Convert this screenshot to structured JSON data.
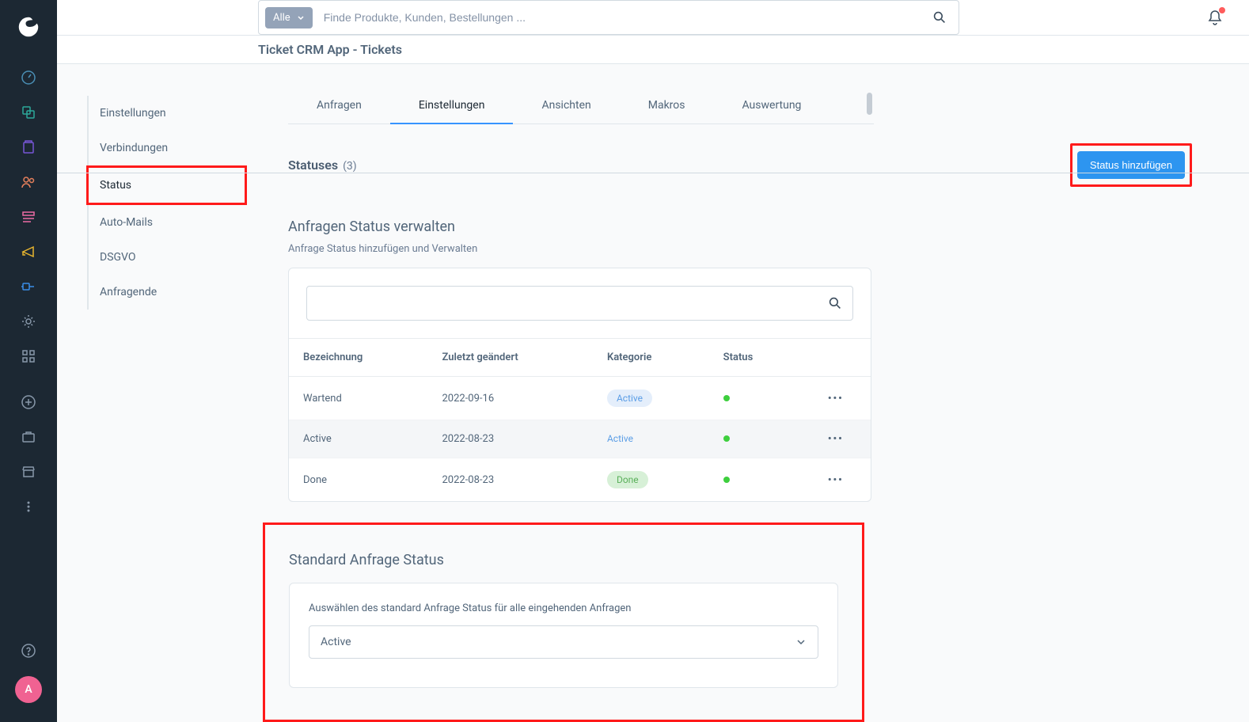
{
  "search": {
    "filter": "Alle",
    "placeholder": "Finde Produkte, Kunden, Bestellungen ..."
  },
  "page_title": "Ticket CRM App - Tickets",
  "avatar_letter": "A",
  "tabs": [
    "Anfragen",
    "Einstellungen",
    "Ansichten",
    "Makros",
    "Auswertung"
  ],
  "active_tab": "Einstellungen",
  "subheader": {
    "title": "Statuses",
    "count": "(3)",
    "add_label": "Status hinzufügen"
  },
  "side_menu": [
    "Einstellungen",
    "Verbindungen",
    "Status",
    "Auto-Mails",
    "DSGVO",
    "Anfragende"
  ],
  "active_side": "Status",
  "section": {
    "title": "Anfragen Status verwalten",
    "subtitle": "Anfrage Status hinzufügen und Verwalten"
  },
  "table": {
    "headers": [
      "Bezeichnung",
      "Zuletzt geändert",
      "Kategorie",
      "Status",
      ""
    ],
    "rows": [
      {
        "name": "Wartend",
        "date": "2022-09-16",
        "category": "Active",
        "cat_type": "active",
        "status": "green"
      },
      {
        "name": "Active",
        "date": "2022-08-23",
        "category": "Active",
        "cat_type": "active",
        "status": "green",
        "highlight": true
      },
      {
        "name": "Done",
        "date": "2022-08-23",
        "category": "Done",
        "cat_type": "done",
        "status": "green"
      }
    ]
  },
  "standard": {
    "title": "Standard Anfrage Status",
    "label": "Auswählen des standard Anfrage Status für alle eingehenden Anfragen",
    "value": "Active"
  }
}
